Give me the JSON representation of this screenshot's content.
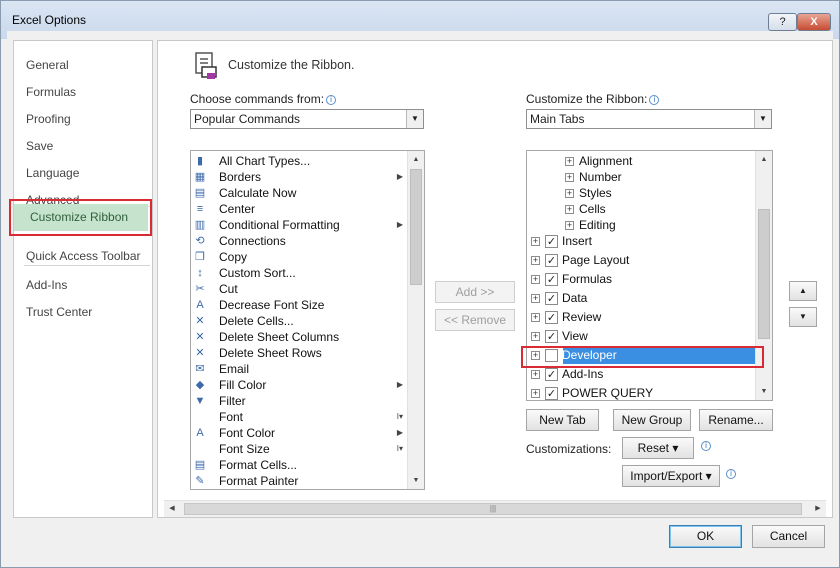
{
  "window": {
    "title": "Excel Options",
    "help_label": "?",
    "close_label": "X"
  },
  "nav": {
    "items": [
      "General",
      "Formulas",
      "Proofing",
      "Save",
      "Language",
      "Advanced",
      "Customize Ribbon",
      "Quick Access Toolbar",
      "Add-Ins",
      "Trust Center"
    ],
    "selected": "Customize Ribbon"
  },
  "main": {
    "heading": "Customize the Ribbon.",
    "choose_label": "Choose commands from:",
    "choose_value": "Popular Commands",
    "customize_label": "Customize the Ribbon:",
    "customize_value": "Main Tabs",
    "commands": [
      {
        "label": "All Chart Types...",
        "icon": "chart-icon",
        "arrow": ""
      },
      {
        "label": "Borders",
        "icon": "borders-icon",
        "arrow": "▶"
      },
      {
        "label": "Calculate Now",
        "icon": "calculator-icon",
        "arrow": ""
      },
      {
        "label": "Center",
        "icon": "align-center-icon",
        "arrow": ""
      },
      {
        "label": "Conditional Formatting",
        "icon": "conditional-formatting-icon",
        "arrow": "▶"
      },
      {
        "label": "Connections",
        "icon": "connections-icon",
        "arrow": ""
      },
      {
        "label": "Copy",
        "icon": "copy-icon",
        "arrow": ""
      },
      {
        "label": "Custom Sort...",
        "icon": "sort-icon",
        "arrow": ""
      },
      {
        "label": "Cut",
        "icon": "scissors-icon",
        "arrow": ""
      },
      {
        "label": "Decrease Font Size",
        "icon": "decrease-font-icon",
        "arrow": ""
      },
      {
        "label": "Delete Cells...",
        "icon": "delete-cells-icon",
        "arrow": ""
      },
      {
        "label": "Delete Sheet Columns",
        "icon": "delete-columns-icon",
        "arrow": ""
      },
      {
        "label": "Delete Sheet Rows",
        "icon": "delete-rows-icon",
        "arrow": ""
      },
      {
        "label": "Email",
        "icon": "email-icon",
        "arrow": ""
      },
      {
        "label": "Fill Color",
        "icon": "fill-color-icon",
        "arrow": "▶"
      },
      {
        "label": "Filter",
        "icon": "filter-icon",
        "arrow": ""
      },
      {
        "label": "Font",
        "icon": "font-icon",
        "arrow": "I▾"
      },
      {
        "label": "Font Color",
        "icon": "font-color-icon",
        "arrow": "▶"
      },
      {
        "label": "Font Size",
        "icon": "font-size-icon",
        "arrow": "I▾"
      },
      {
        "label": "Format Cells...",
        "icon": "format-cells-icon",
        "arrow": ""
      },
      {
        "label": "Format Painter",
        "icon": "format-painter-icon",
        "arrow": ""
      }
    ],
    "add_button": "Add >>",
    "remove_button": "<< Remove",
    "tree_subitems": [
      "Alignment",
      "Number",
      "Styles",
      "Cells",
      "Editing"
    ],
    "tree_tabs": [
      {
        "label": "Insert",
        "checked": true
      },
      {
        "label": "Page Layout",
        "checked": true
      },
      {
        "label": "Formulas",
        "checked": true
      },
      {
        "label": "Data",
        "checked": true
      },
      {
        "label": "Review",
        "checked": true
      },
      {
        "label": "View",
        "checked": true
      },
      {
        "label": "Developer",
        "checked": false
      },
      {
        "label": "Add-Ins",
        "checked": true
      },
      {
        "label": "POWER QUERY",
        "checked": true
      }
    ],
    "new_tab_button": "New Tab",
    "new_group_button": "New Group",
    "rename_button": "Rename...",
    "customizations_label": "Customizations:",
    "reset_button": "Reset ▾",
    "import_export_button": "Import/Export ▾"
  },
  "footer": {
    "ok_button": "OK",
    "cancel_button": "Cancel"
  },
  "colors": {
    "selection_blue": "#3b8fe3",
    "highlight_red": "#d82b34",
    "nav_selected": "#c6e4cd"
  }
}
